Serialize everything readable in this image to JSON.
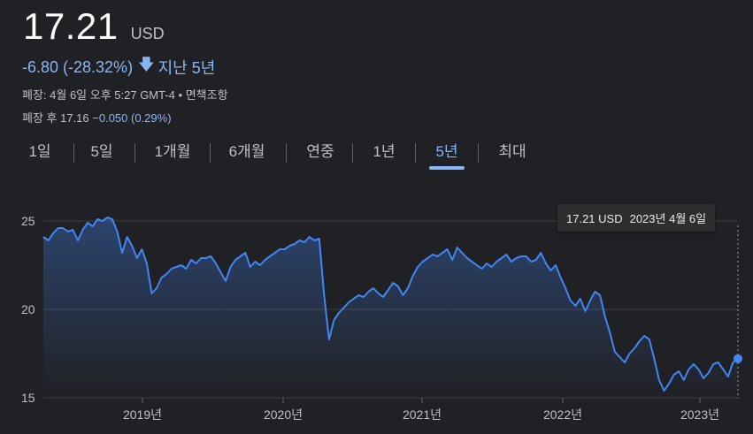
{
  "price": {
    "value": "17.21",
    "currency": "USD"
  },
  "change": {
    "text": "-6.80 (-28.32%)",
    "arrow_icon": "arrow-down-icon",
    "period": "지난 5년"
  },
  "meta": {
    "closed": "폐장: 4월 6일 오후 5:27 GMT-4 • 면책조항",
    "after_hours_label": "폐장 후 17.16",
    "after_hours_change": "−0.050 (0.29%)"
  },
  "tabs": [
    "1일",
    "5일",
    "1개월",
    "6개월",
    "연중",
    "1년",
    "5년",
    "최대"
  ],
  "active_tab": "5년",
  "tooltip": {
    "price": "17.21 USD",
    "date": "2023년 4월 6일"
  },
  "colors": {
    "accent": "#8ab4f8",
    "line": "#4285f4",
    "background": "#202124"
  },
  "chart_data": {
    "type": "area",
    "y_ticks": [
      25,
      20,
      15
    ],
    "x_ticks": [
      "2019년",
      "2020년",
      "2021년",
      "2022년",
      "2023년"
    ],
    "ylim": [
      15,
      26
    ],
    "grid": true,
    "series": [
      {
        "values": [
          24.1,
          23.9,
          24.3,
          24.6,
          24.6,
          24.4,
          24.5,
          23.9,
          24.5,
          24.9,
          24.7,
          25.1,
          25.0,
          25.2,
          25.1,
          24.4,
          23.2,
          24.1,
          23.6,
          22.9,
          23.4,
          22.6,
          20.9,
          21.2,
          21.8,
          22.0,
          22.3,
          22.4,
          22.5,
          22.3,
          22.8,
          22.6,
          22.9,
          22.9,
          23.0,
          22.6,
          22.1,
          21.6,
          22.4,
          22.8,
          23.0,
          23.2,
          22.4,
          22.7,
          22.5,
          22.8,
          23.0,
          23.2,
          23.4,
          23.4,
          23.6,
          23.7,
          23.9,
          23.8,
          24.1,
          23.9,
          24.0,
          20.8,
          18.3,
          19.4,
          19.8,
          20.1,
          20.4,
          20.6,
          20.8,
          20.7,
          21.0,
          21.2,
          20.9,
          20.7,
          21.1,
          21.5,
          21.3,
          20.8,
          21.2,
          21.9,
          22.4,
          22.7,
          22.9,
          23.1,
          23.0,
          23.2,
          23.4,
          22.8,
          23.5,
          23.2,
          22.9,
          22.7,
          22.5,
          22.3,
          22.6,
          22.4,
          22.7,
          22.9,
          23.1,
          22.7,
          22.9,
          23.0,
          23.0,
          22.7,
          22.8,
          23.2,
          22.6,
          22.2,
          22.5,
          21.8,
          21.2,
          20.5,
          20.2,
          20.6,
          19.9,
          20.5,
          21.0,
          20.8,
          19.6,
          18.7,
          17.6,
          17.3,
          17.0,
          17.5,
          17.8,
          18.2,
          18.5,
          18.3,
          17.2,
          16.0,
          15.4,
          15.8,
          16.3,
          16.5,
          16.0,
          16.6,
          16.9,
          16.6,
          16.1,
          16.4,
          16.9,
          17.0,
          16.6,
          16.2,
          17.0,
          17.21
        ]
      }
    ]
  }
}
